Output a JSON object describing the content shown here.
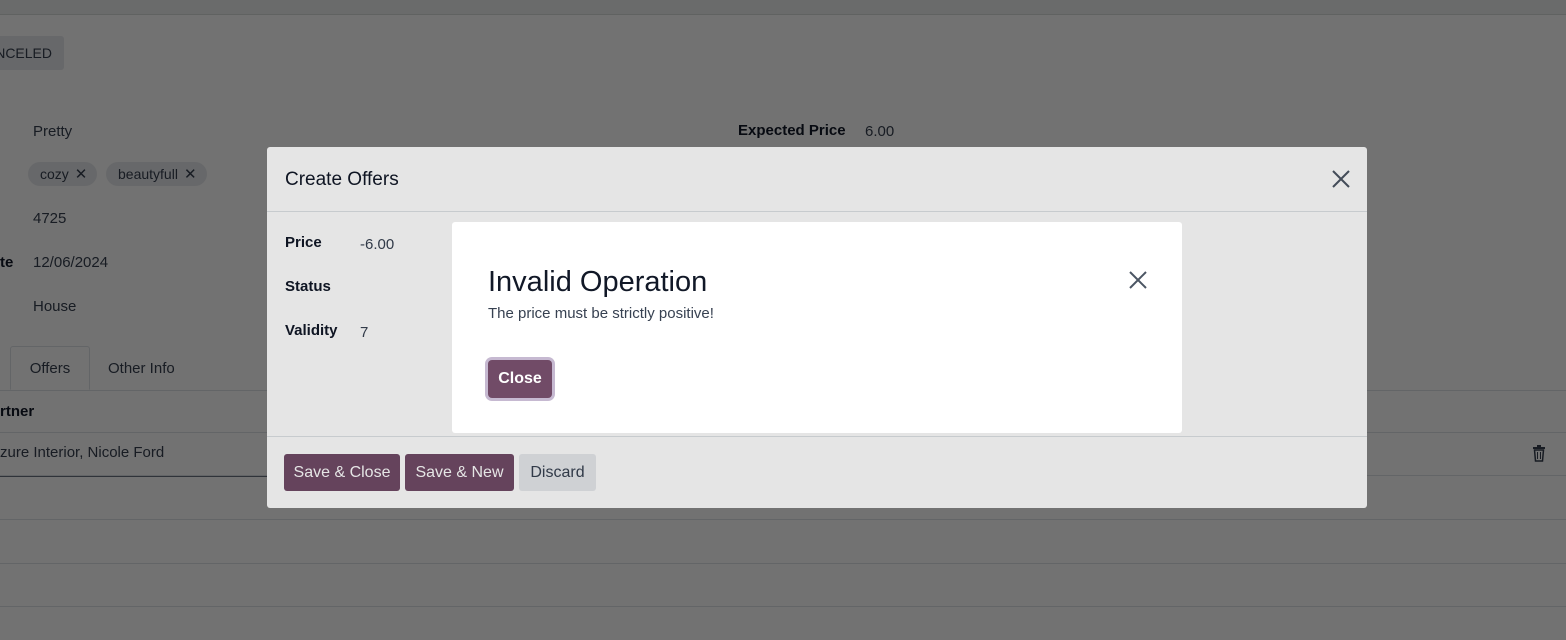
{
  "background": {
    "status_label": "NCELED",
    "fields": {
      "value1": "Pretty",
      "tags": [
        {
          "label": "cozy",
          "remove": "✕"
        },
        {
          "label": "beautyfull",
          "remove": "✕"
        }
      ],
      "value3": "4725",
      "date_label_fragment": "te",
      "date_value": "12/06/2024",
      "type_value": "House",
      "expected_price_label": "Expected Price",
      "expected_price_value": "6.00"
    },
    "tabs": [
      "Offers",
      "Other Info"
    ],
    "table": {
      "column_header": "rtner",
      "rows": [
        "zure Interior, Nicole Ford"
      ]
    }
  },
  "create_offers_dialog": {
    "title": "Create Offers",
    "fields": [
      {
        "label": "Price",
        "value": "-6.00"
      },
      {
        "label": "Status",
        "value": ""
      },
      {
        "label": "Validity",
        "value": "7"
      }
    ],
    "buttons": {
      "save_close": "Save & Close",
      "save_new": "Save & New",
      "discard": "Discard"
    }
  },
  "error_dialog": {
    "title": "Invalid Operation",
    "message": "The price must be strictly positive!",
    "close_label": "Close"
  },
  "colors": {
    "primary": "#714b67",
    "secondary_button": "#e7e9ed",
    "backdrop": "rgba(0,0,0,0.5)"
  },
  "icons": [
    "close-icon",
    "remove-tag-icon",
    "trash-icon"
  ]
}
